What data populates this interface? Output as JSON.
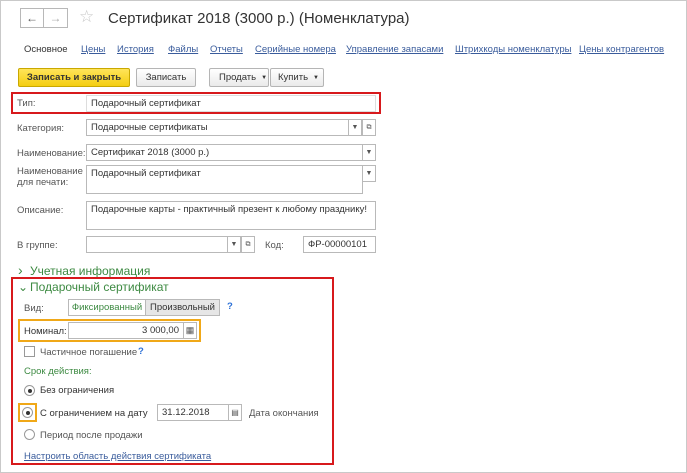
{
  "header": {
    "title": "Сертификат 2018 (3000 р.) (Номенклатура)",
    "back_icon": "←",
    "forward_icon": "→",
    "favorite_icon": "☆"
  },
  "tabs": [
    {
      "label": "Основное"
    },
    {
      "label": "Цены"
    },
    {
      "label": "История"
    },
    {
      "label": "Файлы"
    },
    {
      "label": "Отчеты"
    },
    {
      "label": "Серийные номера"
    },
    {
      "label": "Управление запасами"
    },
    {
      "label": "Штрихкоды номенклатуры"
    },
    {
      "label": "Цены контрагентов"
    }
  ],
  "toolbar": {
    "save_close": "Записать и закрыть",
    "save": "Записать",
    "sell": "Продать",
    "buy": "Купить"
  },
  "form": {
    "type_label": "Тип:",
    "type_value": "Подарочный сертификат",
    "category_label": "Категория:",
    "category_value": "Подарочные сертификаты",
    "name_label": "Наименование:",
    "name_value": "Сертификат 2018 (3000 р.)",
    "print_name_label1": "Наименование",
    "print_name_label2": "для печати:",
    "print_name_value": "Подарочный сертификат",
    "description_label": "Описание:",
    "description_value": "Подарочные карты - практичный презент к любому празднику!",
    "group_label": "В группе:",
    "group_value": "",
    "code_label": "Код:",
    "code_value": "ФР-00000101"
  },
  "accounting": {
    "chevron": "›",
    "label": "Учетная информация"
  },
  "certificate": {
    "chevron": "⌄",
    "header": "Подарочный сертификат",
    "kind_label": "Вид:",
    "kind_fixed": "Фиксированный",
    "kind_free": "Произвольный",
    "help": "?",
    "nominal_label": "Номинал:",
    "nominal_value": "3 000,00",
    "partial_label": "Частичное погашение",
    "validity_label": "Срок действия:",
    "no_limit": "Без ограничения",
    "limit_date_label": "С ограничением на дату",
    "limit_date_value": "31.12.2018",
    "end_date_label": "Дата окончания",
    "after_sale": "Период после продажи",
    "configure_link": "Настроить область действия сертификата"
  }
}
